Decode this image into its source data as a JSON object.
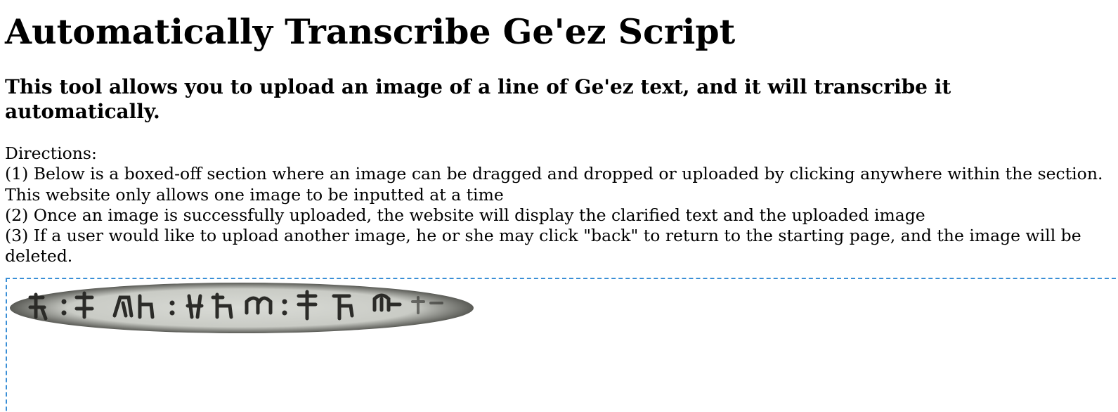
{
  "header": {
    "title": "Automatically Transcribe Ge'ez Script",
    "subtitle": "This tool allows you to upload an image of a line of Ge'ez text, and it will transcribe it automatically."
  },
  "directions": {
    "heading": "Directions:",
    "steps": [
      "(1) Below is a boxed-off section where an image can be dragged and dropped or uploaded by clicking anywhere within the section. This website only allows one image to be inputted at a time",
      "(2) Once an image is successfully uploaded, the website will display the clarified text and the uploaded image",
      "(3) If a user would like to upload another image, he or she may click \"back\" to return to the starting page, and the image will be deleted."
    ]
  },
  "dropzone": {
    "border_color": "#3a8fd6",
    "image_icon": "geez-script-line-image"
  }
}
